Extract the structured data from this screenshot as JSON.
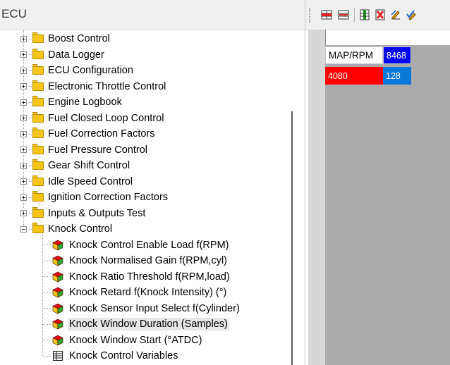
{
  "left": {
    "title": "ECU",
    "tree_items": [
      {
        "label": "Boost Control",
        "type": "folder",
        "expanded": false
      },
      {
        "label": "Data Logger",
        "type": "folder",
        "expanded": false
      },
      {
        "label": "ECU Configuration",
        "type": "folder",
        "expanded": false
      },
      {
        "label": "Electronic Throttle Control",
        "type": "folder",
        "expanded": false
      },
      {
        "label": "Engine Logbook",
        "type": "folder",
        "expanded": false
      },
      {
        "label": "Fuel Closed Loop Control",
        "type": "folder",
        "expanded": false
      },
      {
        "label": "Fuel Correction Factors",
        "type": "folder",
        "expanded": false
      },
      {
        "label": "Fuel Pressure Control",
        "type": "folder",
        "expanded": false
      },
      {
        "label": "Gear Shift Control",
        "type": "folder",
        "expanded": false
      },
      {
        "label": "Idle Speed Control",
        "type": "folder",
        "expanded": false
      },
      {
        "label": "Ignition Correction Factors",
        "type": "folder",
        "expanded": false
      },
      {
        "label": "Inputs & Outputs Test",
        "type": "folder",
        "expanded": false
      },
      {
        "label": "Knock Control",
        "type": "folder",
        "expanded": true
      },
      {
        "label": "Knock Control Enable Load f(RPM)",
        "type": "table-item"
      },
      {
        "label": "Knock Normalised Gain f(RPM,cyl)",
        "type": "table-item"
      },
      {
        "label": "Knock Ratio Threshold f(RPM,load)",
        "type": "table-item"
      },
      {
        "label": "Knock Retard f(Knock Intensity) (°)",
        "type": "table-item"
      },
      {
        "label": "Knock Sensor Input Select f(Cylinder)",
        "type": "table-item"
      },
      {
        "label": "Knock Window Duration (Samples)",
        "type": "table-item",
        "selected": true
      },
      {
        "label": "Knock Window Start (°ATDC)",
        "type": "table-item"
      },
      {
        "label": "Knock Control Variables",
        "type": "variables"
      }
    ]
  },
  "toolbar": {
    "buttons": [
      "insert-row-icon",
      "delete-row-icon",
      "insert-column-icon",
      "delete-column-icon",
      "edit-icon",
      "edit-check-icon"
    ]
  },
  "map_table": {
    "header_label": "MAP/RPM",
    "rpm_value": "8468",
    "map_value": "4080",
    "cell_value": "128"
  },
  "colors": {
    "rpm_bg": "#0000ff",
    "map_bg": "#ff0000",
    "cell_bg": "#0a78d8",
    "cube_red": "#e01010",
    "cube_yellow": "#f5c518",
    "cube_green": "#2eaa2e"
  }
}
